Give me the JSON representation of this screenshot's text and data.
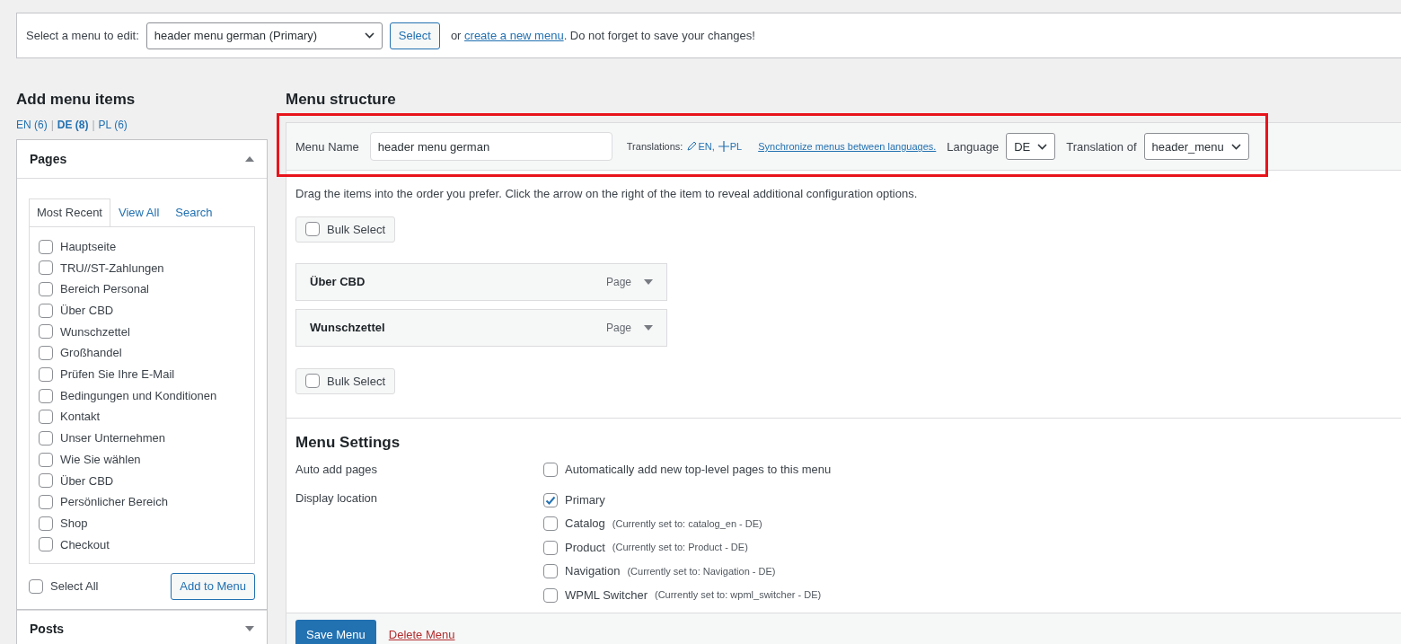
{
  "menu_select": {
    "label": "Select a menu to edit:",
    "value": "header menu german (Primary)",
    "button": "Select",
    "text_before": "or",
    "link": "create a new menu",
    "text_after": ". Do not forget to save your changes!"
  },
  "add_items": {
    "title": "Add menu items",
    "languages": [
      {
        "label": "EN (6)",
        "selected": false
      },
      {
        "label": "DE (8)",
        "selected": true
      },
      {
        "label": "PL (6)",
        "selected": false
      }
    ],
    "separators": [
      "|",
      "|"
    ],
    "pages_box": {
      "title": "Pages",
      "expanded": true,
      "tabs": [
        {
          "label": "Most Recent",
          "selected": true
        },
        {
          "label": "View All",
          "selected": false
        },
        {
          "label": "Search",
          "selected": false
        }
      ],
      "pages": [
        {
          "label": "Hauptseite",
          "checked": false
        },
        {
          "label": "TRU//ST-Zahlungen",
          "checked": false
        },
        {
          "label": "Bereich Personal",
          "checked": false
        },
        {
          "label": "Über CBD",
          "checked": false
        },
        {
          "label": "Wunschzettel",
          "checked": false
        },
        {
          "label": "Großhandel",
          "checked": false
        },
        {
          "label": "Prüfen Sie Ihre E-Mail",
          "checked": false
        },
        {
          "label": "Bedingungen und Konditionen",
          "checked": false
        },
        {
          "label": "Kontakt",
          "checked": false
        },
        {
          "label": "Unser Unternehmen",
          "checked": false
        },
        {
          "label": "Wie Sie wählen",
          "checked": false
        },
        {
          "label": "Über CBD",
          "checked": false
        },
        {
          "label": "Persönlicher Bereich",
          "checked": false
        },
        {
          "label": "Shop",
          "checked": false
        },
        {
          "label": "Checkout",
          "checked": false
        }
      ],
      "select_all": {
        "label": "Select All",
        "checked": false
      },
      "add_button": "Add to Menu"
    },
    "posts_box": {
      "title": "Posts",
      "expanded": false
    }
  },
  "structure": {
    "title": "Menu structure",
    "header": {
      "highlighted": true,
      "name_label": "Menu Name",
      "name_value": "header menu german",
      "translations_label": "Translations:",
      "translations": [
        {
          "kind": "edit",
          "label": "EN,"
        },
        {
          "kind": "add",
          "label": "PL"
        }
      ],
      "sync_link": "Synchronize menus between languages.",
      "language_label": "Language",
      "language_value": "DE",
      "translation_of_label": "Translation of",
      "translation_of_value": "header_menu"
    },
    "instructions": "Drag the items into the order you prefer. Click the arrow on the right of the item to reveal additional configuration options.",
    "bulk_select_top": {
      "label": "Bulk Select",
      "checked": false
    },
    "items": [
      {
        "title": "Über CBD",
        "type": "Page"
      },
      {
        "title": "Wunschzettel",
        "type": "Page"
      }
    ],
    "bulk_select_bottom": {
      "label": "Bulk Select",
      "checked": false
    },
    "settings": {
      "title": "Menu Settings",
      "auto_add_label": "Auto add pages",
      "auto_add": {
        "label": "Automatically add new top-level pages to this menu",
        "checked": false
      },
      "display_label": "Display location",
      "locations": [
        {
          "name": "Primary",
          "checked": true
        },
        {
          "name": "Catalog",
          "note": "(Currently set to: catalog_en - DE)",
          "checked": false
        },
        {
          "name": "Product",
          "note": "(Currently set to: Product - DE)",
          "checked": false
        },
        {
          "name": "Navigation",
          "note": "(Currently set to: Navigation - DE)",
          "checked": false
        },
        {
          "name": "WPML Switcher",
          "note": "(Currently set to: wpml_switcher - DE)",
          "checked": false
        }
      ]
    },
    "save_button": "Save Menu",
    "delete_link": "Delete Menu"
  }
}
